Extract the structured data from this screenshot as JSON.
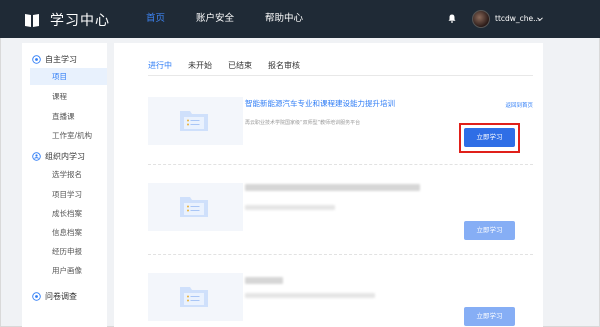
{
  "header": {
    "brand": "学习中心",
    "nav": [
      {
        "label": "首页",
        "active": true
      },
      {
        "label": "账户安全",
        "active": false
      },
      {
        "label": "帮助中心",
        "active": false
      }
    ],
    "username": "ttcdw_che..."
  },
  "sidebar": {
    "groups": [
      {
        "label": "自主学习",
        "icon": "circle-icon",
        "items": [
          "项目",
          "课程",
          "直播课",
          "工作室/机构"
        ]
      },
      {
        "label": "组织内学习",
        "icon": "person-icon",
        "items": [
          "选学报名",
          "项目学习",
          "成长档案",
          "信息档案",
          "经历申报",
          "用户画像"
        ]
      },
      {
        "label": "问卷调查",
        "icon": "circle-icon",
        "items": []
      }
    ],
    "active_item": "项目"
  },
  "tabs": [
    {
      "label": "进行中",
      "active": true
    },
    {
      "label": "未开始",
      "active": false
    },
    {
      "label": "已结束",
      "active": false
    },
    {
      "label": "报名审核",
      "active": false
    }
  ],
  "projects": [
    {
      "title": "智能新能源汽车专业和课程建设能力提升培训",
      "subtitle": "再云职业技术学院国家级“双师型”教师培训服务平台",
      "topic_link": "返回到首页",
      "button": "立即学习",
      "highlighted": true
    },
    {
      "title": "",
      "subtitle": "",
      "button": "立即学习",
      "highlighted": false
    },
    {
      "title": "",
      "subtitle": "",
      "button": "立即学习",
      "highlighted": false
    }
  ],
  "colors": {
    "topbar": "#1f2a36",
    "accent": "#2f7df6",
    "button": "#2f6ee6",
    "highlight": "#e0201a"
  }
}
